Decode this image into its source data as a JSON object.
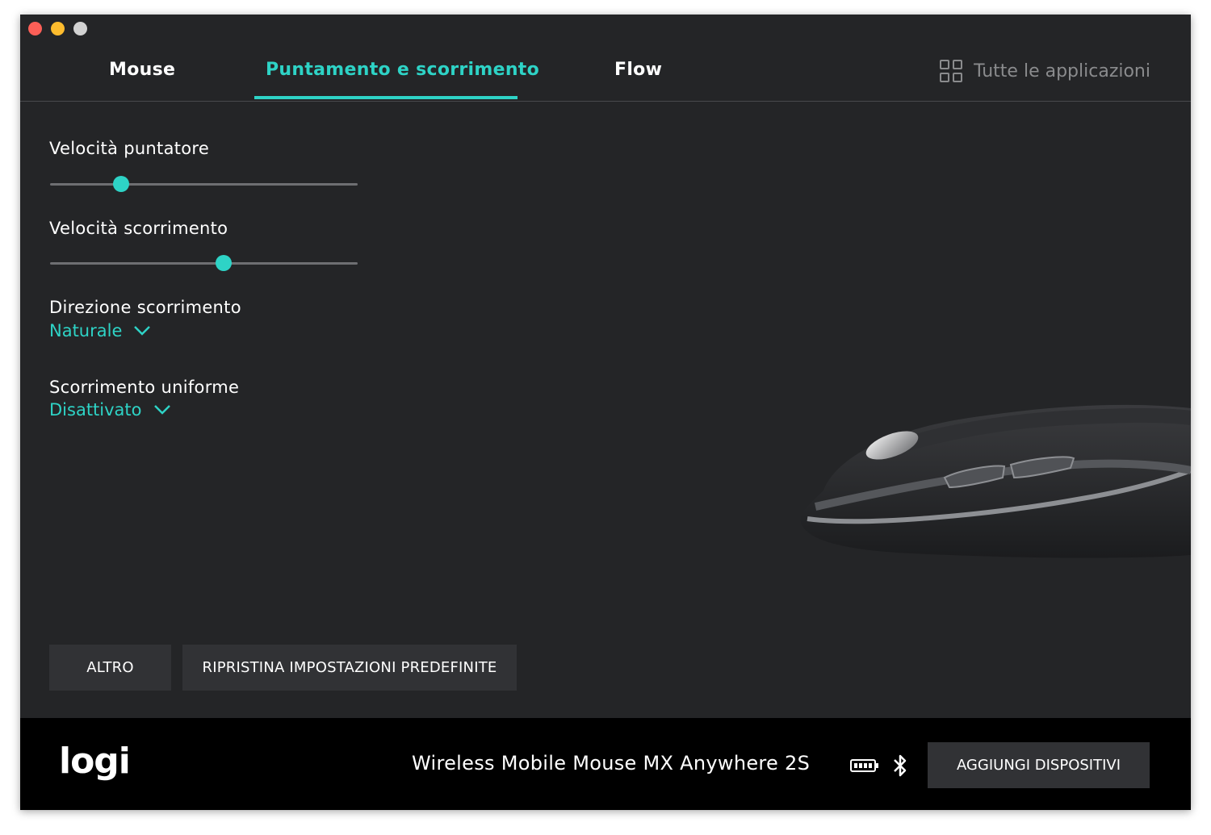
{
  "window": {
    "title": ""
  },
  "tabs": [
    {
      "label": "Mouse"
    },
    {
      "label": "Puntamento e scorrimento",
      "active": true
    },
    {
      "label": "Flow"
    }
  ],
  "all_apps": {
    "label": "Tutte le applicazioni",
    "icon": "grid-icon"
  },
  "settings": {
    "pointer_speed": {
      "label": "Velocità puntatore",
      "value": 0.23
    },
    "scroll_speed": {
      "label": "Velocità scorrimento",
      "value": 0.565
    },
    "scroll_direction": {
      "label": "Direzione scorrimento",
      "value": "Naturale"
    },
    "smooth_scroll": {
      "label": "Scorrimento uniforme",
      "value": "Disattivato"
    }
  },
  "buttons": {
    "more": "ALTRO",
    "restore": "RIPRISTINA IMPOSTAZIONI PREDEFINITE",
    "add_devices": "AGGIUNGI DISPOSITIVI"
  },
  "footer": {
    "logo": "logi",
    "device_name": "Wireless Mobile Mouse MX Anywhere 2S",
    "battery_icon": "battery-icon",
    "bluetooth_icon": "bluetooth-icon"
  },
  "colors": {
    "accent": "#2ed3c6",
    "background": "#242527",
    "footer": "#000000"
  }
}
